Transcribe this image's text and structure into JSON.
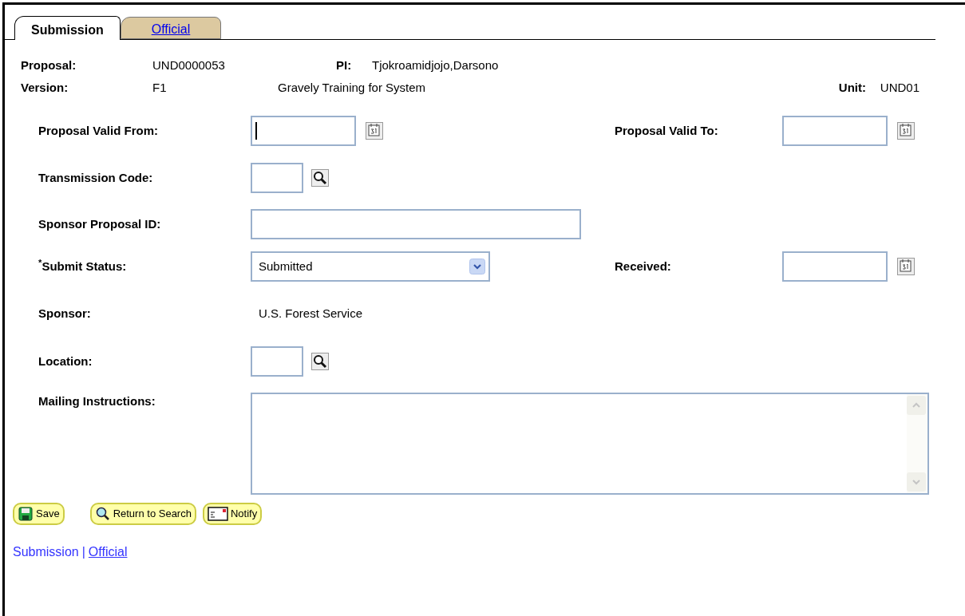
{
  "tabs": [
    {
      "label": "Submission",
      "selected": true
    },
    {
      "label": "Official",
      "selected": false
    }
  ],
  "header": {
    "proposal_label": "Proposal:",
    "proposal": "UND0000053",
    "pi_label": "PI:",
    "pi": "Tjokroamidjojo,Darsono",
    "version_label": "Version:",
    "version": "F1",
    "title": "Gravely Training for System",
    "unit_label": "Unit:",
    "unit": "UND01"
  },
  "rows": [
    {
      "left": {
        "label": "Proposal Valid From:",
        "kind": "date",
        "focused": true
      },
      "right": {
        "label": "Proposal Valid To:",
        "kind": "date",
        "focused": false
      }
    },
    {
      "left": {
        "label": "Transmission Code:",
        "kind": "lookup"
      }
    },
    {
      "left": {
        "label": "Sponsor Proposal ID:",
        "kind": "text"
      }
    },
    {
      "left": {
        "label": "$^{*}$Submit Status:",
        "kind": "select",
        "value": "Submitted"
      },
      "right": {
        "label": "Received:",
        "kind": "date",
        "focused": false
      }
    },
    {
      "left": {
        "label": "Sponsor:",
        "kind": "display",
        "value": "U.S. Forest Service"
      }
    },
    {
      "left": {
        "label": "Location:",
        "kind": "lookup"
      }
    },
    {
      "left": {
        "label": "Mailing Instructions:",
        "kind": "textarea"
      }
    }
  ],
  "buttons": [
    {
      "label": "Save",
      "kind": "save"
    },
    {
      "label": "Return to Search",
      "kind": "search"
    },
    {
      "label": "Notify",
      "kind": "notify"
    }
  ],
  "footer_links": [
    {
      "label": "Submission",
      "selected": true
    },
    {
      "label": "Official",
      "selected": false
    }
  ],
  "footer_separator": "|"
}
